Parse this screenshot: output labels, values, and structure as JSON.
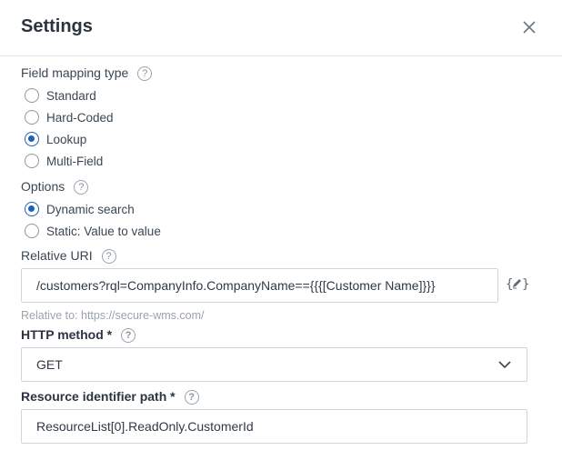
{
  "dialog": {
    "title": "Settings"
  },
  "field_mapping": {
    "label": "Field mapping type",
    "help_glyph": "?",
    "options": [
      {
        "label": "Standard",
        "checked": false
      },
      {
        "label": "Hard-Coded",
        "checked": false
      },
      {
        "label": "Lookup",
        "checked": true
      },
      {
        "label": "Multi-Field",
        "checked": false
      }
    ]
  },
  "options_group": {
    "label": "Options",
    "help_glyph": "?",
    "options": [
      {
        "label": "Dynamic search",
        "checked": true
      },
      {
        "label": "Static: Value to value",
        "checked": false
      }
    ]
  },
  "relative_uri": {
    "label": "Relative URI",
    "help_glyph": "?",
    "value": "/customers?rql=CompanyInfo.CompanyName=={{{[Customer Name]}}}",
    "hint": "Relative to: https://secure-wms.com/"
  },
  "http_method": {
    "label": "HTTP method *",
    "help_glyph": "?",
    "value": "GET"
  },
  "resource_path": {
    "label": "Resource identifier path *",
    "help_glyph": "?",
    "value": "ResourceList[0].ReadOnly.CustomerId"
  },
  "icons": {
    "close": "close-icon",
    "help": "help-icon",
    "token_editor": "token-editor-icon",
    "dropdown": "chevron-down-icon"
  },
  "colors": {
    "accent": "#1c62b9",
    "border": "#cfd5dc",
    "hint": "#9aa3ad"
  }
}
